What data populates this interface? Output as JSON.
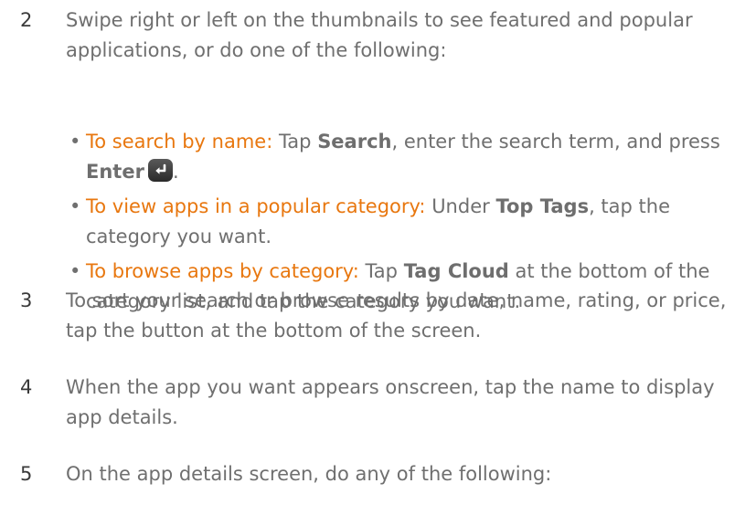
{
  "steps": [
    {
      "number": "2",
      "text": "Swipe right or left on the thumbnails to see featured and popular applications, or do one of the following:",
      "bullets": [
        {
          "lead": "To search by name:",
          "parts": [
            " Tap ",
            "Search",
            ", enter the search term, and press ",
            "Enter",
            "."
          ]
        },
        {
          "lead": "To view apps in a popular category:",
          "parts": [
            " Under ",
            "Top Tags",
            ", tap the category you want."
          ]
        },
        {
          "lead": "To browse apps by category:",
          "parts": [
            " Tap ",
            "Tag Cloud",
            " at the bottom of the category list, and tap the category you want."
          ]
        }
      ]
    },
    {
      "number": "3",
      "text": "To sort your search or browse results by date, name, rating, or price, tap the button at the bottom of the screen."
    },
    {
      "number": "4",
      "text": "When the app you want appears onscreen, tap the name to display app details."
    },
    {
      "number": "5",
      "text": "On the app details screen, do any of the following:"
    }
  ],
  "colors": {
    "body_text": "#6f6f6f",
    "lead_text": "#e8770f",
    "enter_key": "#2a2a2a"
  },
  "icons": {
    "enter_key": "enter-key-icon"
  }
}
